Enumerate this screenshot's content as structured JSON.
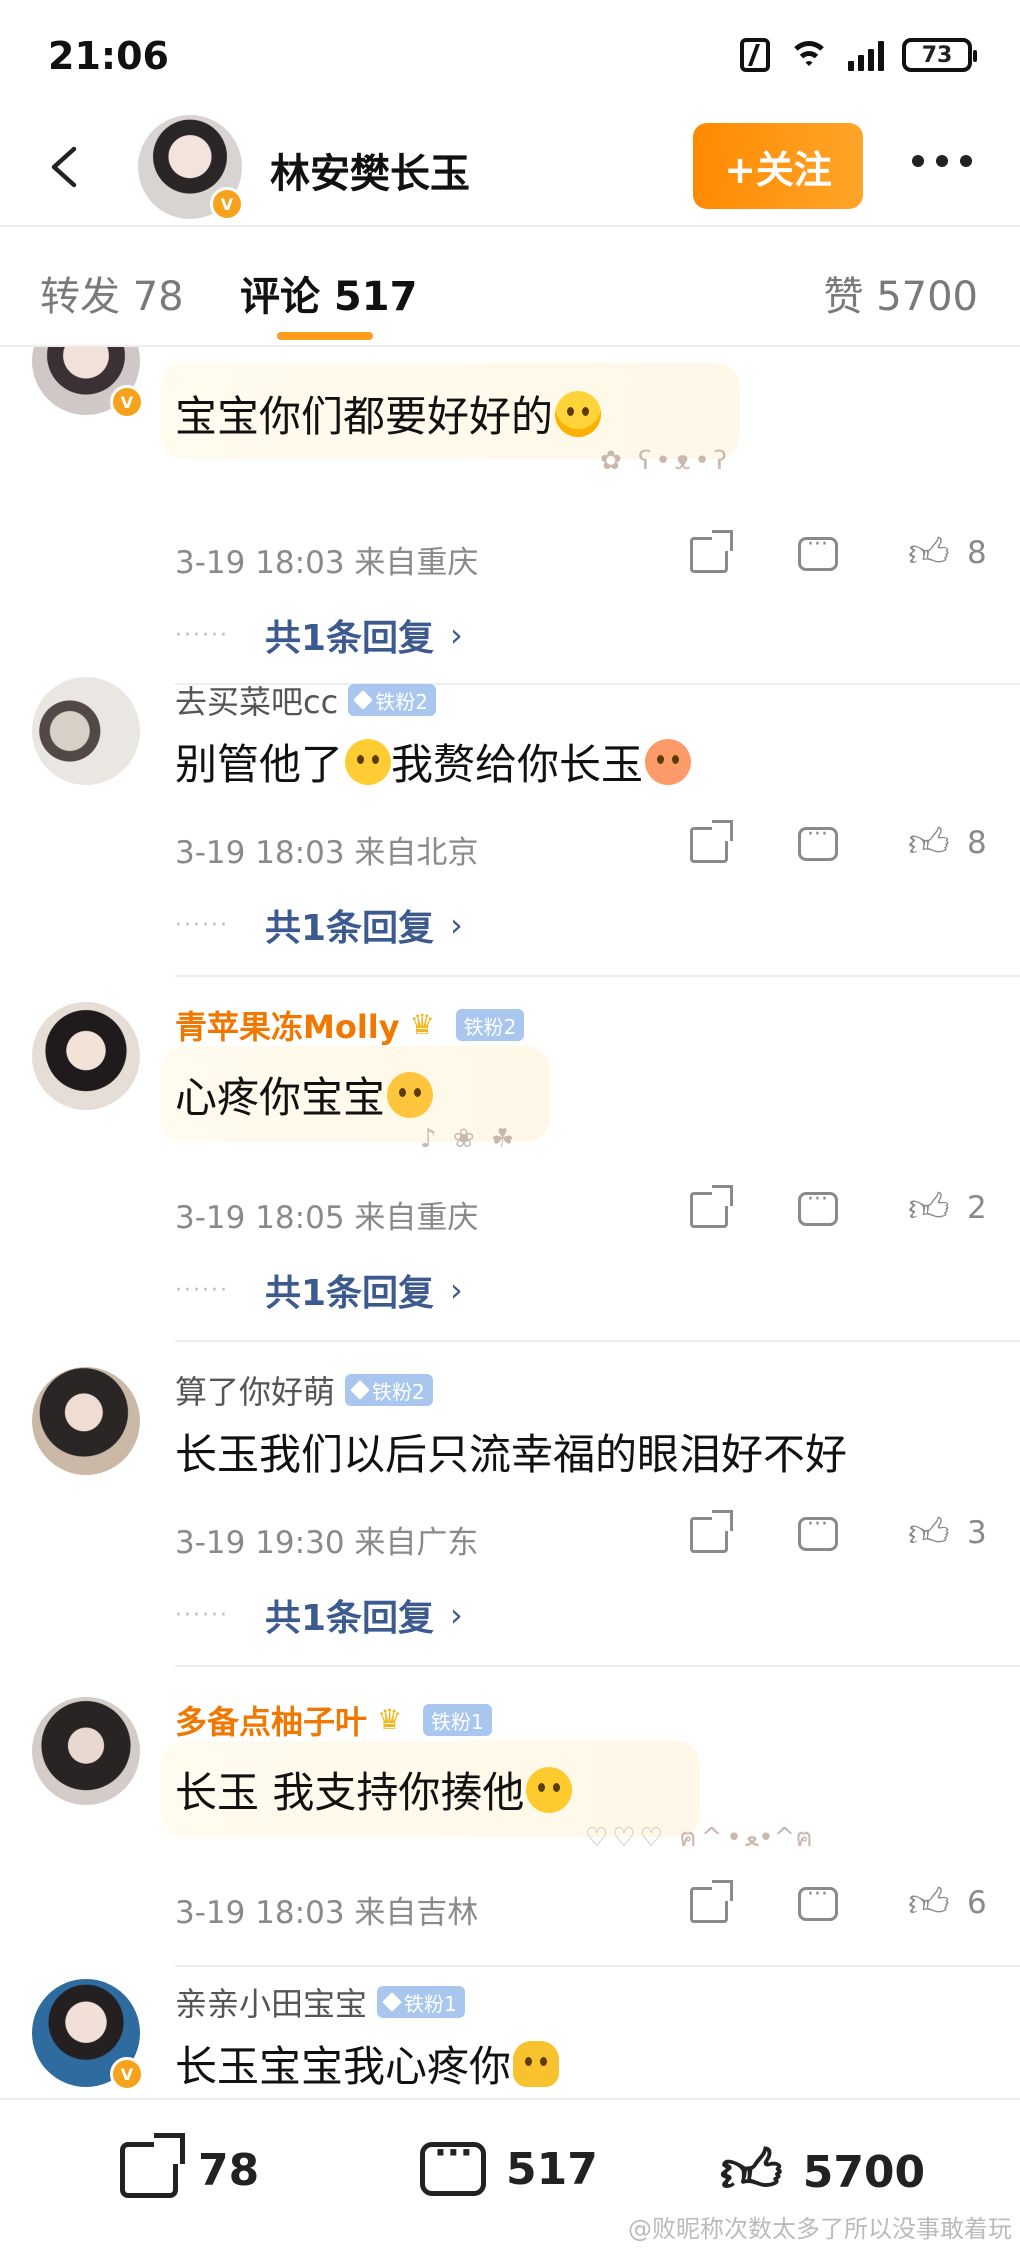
{
  "status": {
    "time": "21:06",
    "battery": "73"
  },
  "header": {
    "name": "林安樊长玉",
    "follow_label": "+关注",
    "verified_mark": "V"
  },
  "tabs": {
    "repost": "转发 78",
    "comments": "评论 517",
    "likes": "赞 5700"
  },
  "comments": [
    {
      "username": "",
      "text": "宝宝你们都要好好的",
      "meta": "3-19 18:03 来自重庆",
      "likes": "8",
      "replies": "共1条回复"
    },
    {
      "username": "去买菜吧cc",
      "badge": "铁粉2",
      "text": "别管他了",
      "text2": "我赘给你长玉",
      "meta": "3-19 18:03 来自北京",
      "likes": "8",
      "replies": "共1条回复"
    },
    {
      "username": "青苹果冻Molly",
      "badge": "铁粉2",
      "text": "心疼你宝宝",
      "meta": "3-19 18:05 来自重庆",
      "likes": "2",
      "replies": "共1条回复"
    },
    {
      "username": "算了你好萌",
      "badge": "铁粉2",
      "text": "长玉我们以后只流幸福的眼泪好不好",
      "meta": "3-19 19:30 来自广东",
      "likes": "3",
      "replies": "共1条回复"
    },
    {
      "username": "多备点柚子叶",
      "badge": "铁粉1",
      "text": "长玉 我支持你揍他",
      "meta": "3-19 18:03 来自吉林",
      "likes": "6"
    },
    {
      "username": "亲亲小田宝宝",
      "badge": "铁粉1",
      "text": "长玉宝宝我心疼你"
    }
  ],
  "bottom": {
    "shares": "78",
    "comments": "517",
    "likes": "5700"
  },
  "watermark": "@败昵称次数太多了所以没事敢着玩",
  "colors": {
    "accent": "#ff9a1f",
    "orange_name": "#f07800",
    "reply_link": "#3c5a8f",
    "fan_badge": "#a9c6ef"
  }
}
